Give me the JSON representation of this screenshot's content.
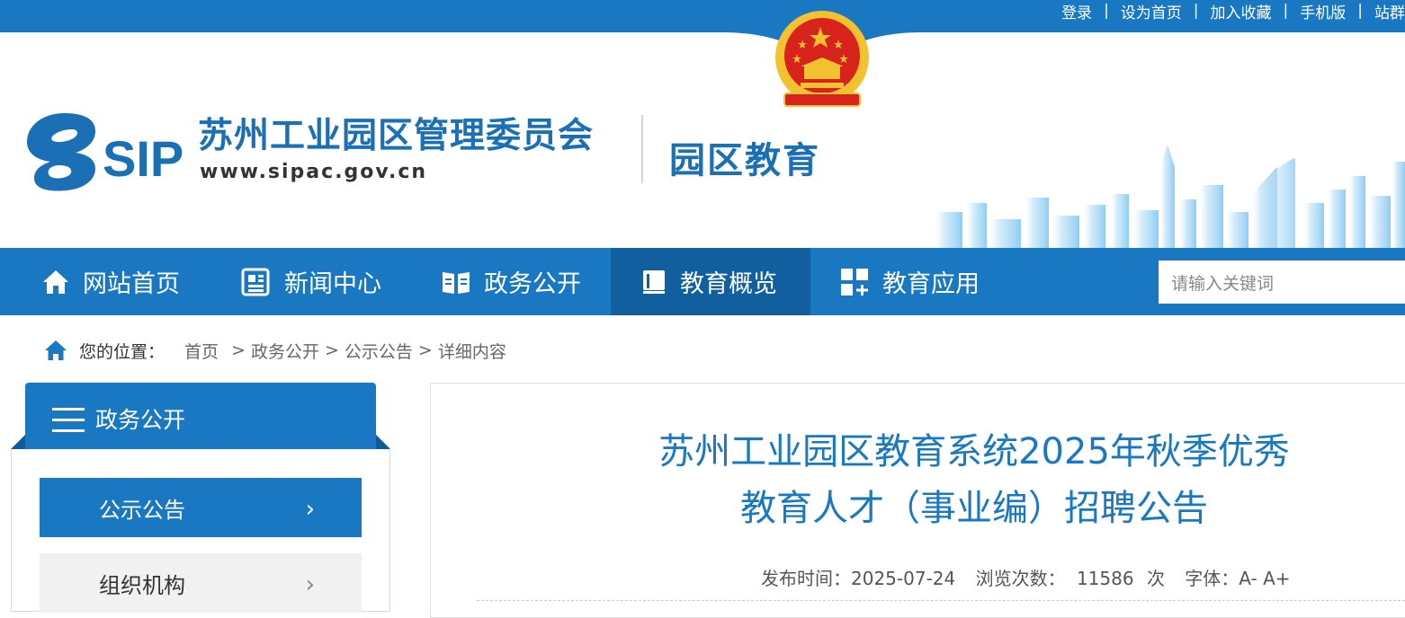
{
  "top_links": [
    "登录",
    "设为首页",
    "加入收藏",
    "手机版",
    "站群"
  ],
  "header": {
    "logo_text": "SIP",
    "org_name": "苏州工业园区管理委员会",
    "org_url": "www.sipac.gov.cn",
    "section_name": "园区教育"
  },
  "nav": {
    "items": [
      {
        "label": "网站首页",
        "icon": "home-icon"
      },
      {
        "label": "新闻中心",
        "icon": "news-icon"
      },
      {
        "label": "政务公开",
        "icon": "book-icon"
      },
      {
        "label": "教育概览",
        "icon": "notebook-icon",
        "active": true
      },
      {
        "label": "教育应用",
        "icon": "apps-icon"
      }
    ],
    "search_placeholder": "请输入关键词"
  },
  "breadcrumb": {
    "label": "您的位置：",
    "items": [
      "首页",
      "政务公开",
      "公示公告",
      "详细内容"
    ]
  },
  "sidebar": {
    "title": "政务公开",
    "items": [
      {
        "label": "公示公告",
        "active": true
      },
      {
        "label": "组织机构",
        "active": false
      }
    ]
  },
  "article": {
    "title_line1": "苏州工业园区教育系统2025年秋季优秀",
    "title_line2": "教育人才（事业编）招聘公告",
    "publish_label": "发布时间：",
    "publish_date": "2025-07-24",
    "views_label": "浏览次数：",
    "views_count": "11586",
    "views_unit": "次",
    "font_label": "字体：",
    "font_smaller": "A-",
    "font_larger": "A+"
  },
  "colors": {
    "primary": "#1a78c2",
    "nav_active": "#125f9f",
    "emblem_red": "#d8231c",
    "emblem_gold": "#f2c231"
  }
}
